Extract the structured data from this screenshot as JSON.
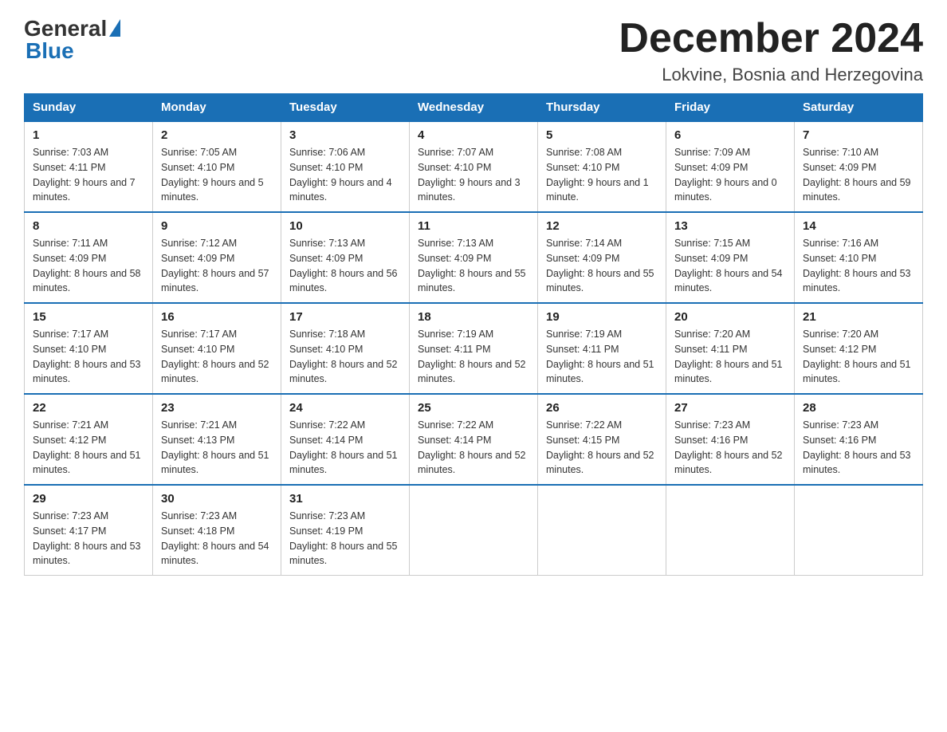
{
  "header": {
    "logo": {
      "general": "General",
      "blue": "Blue"
    },
    "title": "December 2024",
    "location": "Lokvine, Bosnia and Herzegovina"
  },
  "calendar": {
    "days_of_week": [
      "Sunday",
      "Monday",
      "Tuesday",
      "Wednesday",
      "Thursday",
      "Friday",
      "Saturday"
    ],
    "weeks": [
      [
        {
          "day": "1",
          "sunrise": "7:03 AM",
          "sunset": "4:11 PM",
          "daylight": "9 hours and 7 minutes."
        },
        {
          "day": "2",
          "sunrise": "7:05 AM",
          "sunset": "4:10 PM",
          "daylight": "9 hours and 5 minutes."
        },
        {
          "day": "3",
          "sunrise": "7:06 AM",
          "sunset": "4:10 PM",
          "daylight": "9 hours and 4 minutes."
        },
        {
          "day": "4",
          "sunrise": "7:07 AM",
          "sunset": "4:10 PM",
          "daylight": "9 hours and 3 minutes."
        },
        {
          "day": "5",
          "sunrise": "7:08 AM",
          "sunset": "4:10 PM",
          "daylight": "9 hours and 1 minute."
        },
        {
          "day": "6",
          "sunrise": "7:09 AM",
          "sunset": "4:09 PM",
          "daylight": "9 hours and 0 minutes."
        },
        {
          "day": "7",
          "sunrise": "7:10 AM",
          "sunset": "4:09 PM",
          "daylight": "8 hours and 59 minutes."
        }
      ],
      [
        {
          "day": "8",
          "sunrise": "7:11 AM",
          "sunset": "4:09 PM",
          "daylight": "8 hours and 58 minutes."
        },
        {
          "day": "9",
          "sunrise": "7:12 AM",
          "sunset": "4:09 PM",
          "daylight": "8 hours and 57 minutes."
        },
        {
          "day": "10",
          "sunrise": "7:13 AM",
          "sunset": "4:09 PM",
          "daylight": "8 hours and 56 minutes."
        },
        {
          "day": "11",
          "sunrise": "7:13 AM",
          "sunset": "4:09 PM",
          "daylight": "8 hours and 55 minutes."
        },
        {
          "day": "12",
          "sunrise": "7:14 AM",
          "sunset": "4:09 PM",
          "daylight": "8 hours and 55 minutes."
        },
        {
          "day": "13",
          "sunrise": "7:15 AM",
          "sunset": "4:09 PM",
          "daylight": "8 hours and 54 minutes."
        },
        {
          "day": "14",
          "sunrise": "7:16 AM",
          "sunset": "4:10 PM",
          "daylight": "8 hours and 53 minutes."
        }
      ],
      [
        {
          "day": "15",
          "sunrise": "7:17 AM",
          "sunset": "4:10 PM",
          "daylight": "8 hours and 53 minutes."
        },
        {
          "day": "16",
          "sunrise": "7:17 AM",
          "sunset": "4:10 PM",
          "daylight": "8 hours and 52 minutes."
        },
        {
          "day": "17",
          "sunrise": "7:18 AM",
          "sunset": "4:10 PM",
          "daylight": "8 hours and 52 minutes."
        },
        {
          "day": "18",
          "sunrise": "7:19 AM",
          "sunset": "4:11 PM",
          "daylight": "8 hours and 52 minutes."
        },
        {
          "day": "19",
          "sunrise": "7:19 AM",
          "sunset": "4:11 PM",
          "daylight": "8 hours and 51 minutes."
        },
        {
          "day": "20",
          "sunrise": "7:20 AM",
          "sunset": "4:11 PM",
          "daylight": "8 hours and 51 minutes."
        },
        {
          "day": "21",
          "sunrise": "7:20 AM",
          "sunset": "4:12 PM",
          "daylight": "8 hours and 51 minutes."
        }
      ],
      [
        {
          "day": "22",
          "sunrise": "7:21 AM",
          "sunset": "4:12 PM",
          "daylight": "8 hours and 51 minutes."
        },
        {
          "day": "23",
          "sunrise": "7:21 AM",
          "sunset": "4:13 PM",
          "daylight": "8 hours and 51 minutes."
        },
        {
          "day": "24",
          "sunrise": "7:22 AM",
          "sunset": "4:14 PM",
          "daylight": "8 hours and 51 minutes."
        },
        {
          "day": "25",
          "sunrise": "7:22 AM",
          "sunset": "4:14 PM",
          "daylight": "8 hours and 52 minutes."
        },
        {
          "day": "26",
          "sunrise": "7:22 AM",
          "sunset": "4:15 PM",
          "daylight": "8 hours and 52 minutes."
        },
        {
          "day": "27",
          "sunrise": "7:23 AM",
          "sunset": "4:16 PM",
          "daylight": "8 hours and 52 minutes."
        },
        {
          "day": "28",
          "sunrise": "7:23 AM",
          "sunset": "4:16 PM",
          "daylight": "8 hours and 53 minutes."
        }
      ],
      [
        {
          "day": "29",
          "sunrise": "7:23 AM",
          "sunset": "4:17 PM",
          "daylight": "8 hours and 53 minutes."
        },
        {
          "day": "30",
          "sunrise": "7:23 AM",
          "sunset": "4:18 PM",
          "daylight": "8 hours and 54 minutes."
        },
        {
          "day": "31",
          "sunrise": "7:23 AM",
          "sunset": "4:19 PM",
          "daylight": "8 hours and 55 minutes."
        },
        null,
        null,
        null,
        null
      ]
    ]
  }
}
